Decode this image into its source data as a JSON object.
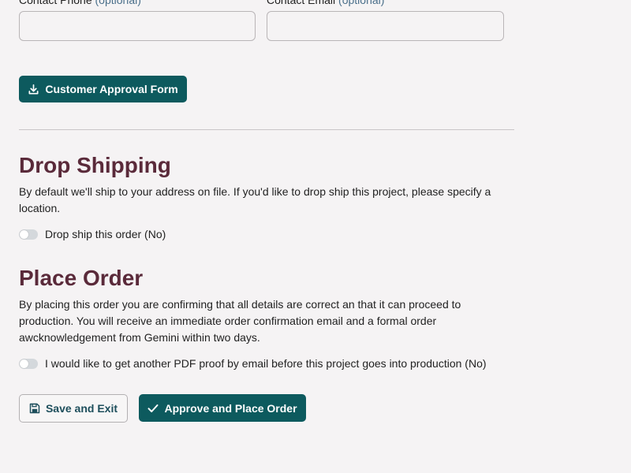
{
  "contact": {
    "phone_label": "Contact Phone",
    "email_label": "Contact Email",
    "optional_label": "(optional)",
    "phone_value": "",
    "email_value": ""
  },
  "approval_form_button": {
    "label": "Customer Approval Form",
    "icon": "download-icon"
  },
  "drop_shipping": {
    "heading": "Drop Shipping",
    "description": "By default we'll ship to your address on file. If you'd like to drop ship this project, please specify a location.",
    "toggle_label": "Drop ship this order (No)",
    "toggle_on": false
  },
  "place_order": {
    "heading": "Place Order",
    "description": "By placing this order you are confirming that all details are correct an that it can proceed to production. You will receive an immediate order confirmation email and a formal order awcknowledgement from Gemini within two days.",
    "toggle_label": "I would like to get another PDF proof by email before this project goes into production (No)",
    "toggle_on": false
  },
  "actions": {
    "save_label": "Save and Exit",
    "save_icon": "floppy-disk-icon",
    "approve_label": "Approve and Place Order",
    "approve_icon": "checkmark-icon"
  },
  "colors": {
    "primary": "#0d5a5e",
    "heading": "#5a2a3a",
    "optional_text": "#4a6f8a",
    "background": "#f5f3f4"
  }
}
